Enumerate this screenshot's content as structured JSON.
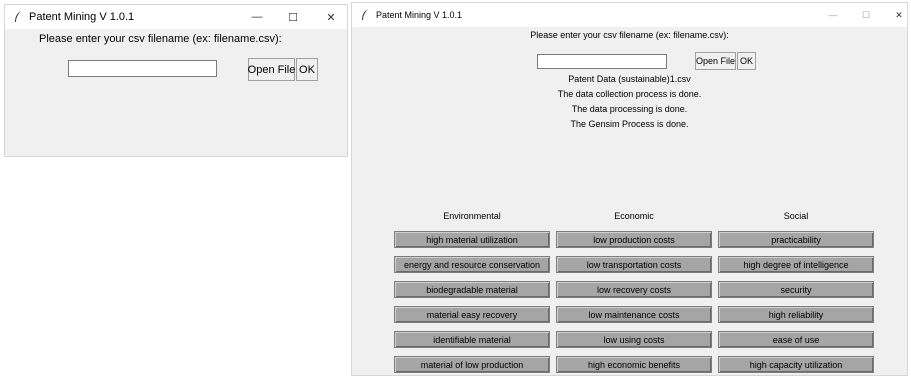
{
  "win1": {
    "title": "Patent Mining V 1.0.1",
    "prompt": "Please enter your csv filename (ex: filename.csv):",
    "filename_value": "",
    "open_file_label": "Open File",
    "ok_label": "OK",
    "minimize": "—",
    "maximize": "☐",
    "close": "✕"
  },
  "win2": {
    "title": "Patent Mining V 1.0.1",
    "prompt": "Please enter your csv filename (ex: filename.csv):",
    "filename_value": "",
    "open_file_label": "Open File",
    "ok_label": "OK",
    "minimize": "—",
    "maximize": "☐",
    "close": "✕",
    "status": [
      "Patent Data (sustainable)1.csv",
      "The data collection process is done.",
      "The data processing is done.",
      "The Gensim Process is done."
    ],
    "columns": [
      {
        "heading": "Environmental",
        "items": [
          "high material utilization",
          "energy and resource conservation",
          "biodegradable material",
          "material easy recovery",
          "identifiable material",
          "material of low production"
        ]
      },
      {
        "heading": "Economic",
        "items": [
          "low production costs",
          "low transportation costs",
          "low recovery costs",
          "low maintenance costs",
          "low using costs",
          "high economic benefits"
        ]
      },
      {
        "heading": "Social",
        "items": [
          "practicability",
          "high degree of intelligence",
          "security",
          "high reliability",
          "ease of use",
          "high capacity utilization"
        ]
      }
    ]
  },
  "colors": {
    "window_bg": "#f0f0f0",
    "keyword_button_bg": "#a5a5a5",
    "feather_icon": "#1f3a78"
  }
}
